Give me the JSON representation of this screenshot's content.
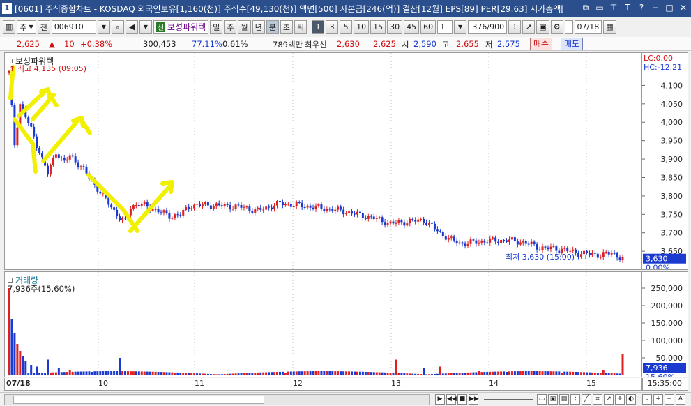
{
  "window": {
    "title": "[0601] 주식종합차트 - KOSDAQ 외국인보유[1,160(천)] 주식수[49,130(천)] 액면[500] 자본금[246(억)] 결산[12월] EPS[89] PER[29.63] 시가총액["
  },
  "toolbar": {
    "period_select": "주",
    "prefix": "전",
    "code": "006910",
    "name_badge": "신",
    "name": "보성파워텍",
    "period_buttons": [
      "일",
      "주",
      "월",
      "년",
      "분",
      "초",
      "틱"
    ],
    "interval_buttons": [
      "1",
      "3",
      "5",
      "10",
      "15",
      "30",
      "45",
      "60"
    ],
    "interval_select": "1",
    "count": "376",
    "count_max": "/900",
    "date": "07/18"
  },
  "pricebar": {
    "current": "2,625",
    "change_arrow": "▲",
    "change": "10",
    "change_pct": "+0.38%",
    "volume": "300,453",
    "volume_ratio": "77.11%",
    "turnover": "0.61%",
    "amount": "789백만",
    "best_label": "최우선",
    "best_ask": "2,630",
    "best_bid": "2,625",
    "open_label": "시",
    "open": "2,590",
    "high_label": "고",
    "high": "2,655",
    "low_label": "저",
    "low": "2,575",
    "buy_button": "매수",
    "sell_button": "매도"
  },
  "price_panel": {
    "legend": "보성파워텍",
    "high_note": "최고 4,135 (09:05)",
    "low_note": "최저 3,630 (15:00)",
    "lc": "LC:0.00",
    "hc": "HC:-12.21",
    "current_tag": "3,630",
    "current_pct": "0.00%",
    "y_ticks": [
      "4,100",
      "4,050",
      "4,000",
      "3,950",
      "3,900",
      "3,850",
      "3,800",
      "3,750",
      "3,700",
      "3,650"
    ]
  },
  "volume_panel": {
    "legend": "거래량",
    "note": "7,936주(15.60%)",
    "current_tag": "7,936",
    "current_pct": "15.60%",
    "y_ticks": [
      "250,000",
      "200,000",
      "150,000",
      "100,000",
      "50,000"
    ]
  },
  "xaxis": {
    "labels": [
      "07/18",
      "10",
      "11",
      "12",
      "13",
      "14",
      "15"
    ],
    "time": "15:35:00"
  },
  "colors": {
    "up": "#e02020",
    "down": "#1a3ad0",
    "annotation": "#f0f000",
    "titlebar": "#2b4f8c"
  },
  "chart_data": {
    "type": "candlestick",
    "title": "보성파워텍",
    "x_labels": [
      "07/18",
      "10",
      "11",
      "12",
      "13",
      "14",
      "15"
    ],
    "ylim": [
      3620,
      4150
    ],
    "price_path": [
      [
        0,
        4135
      ],
      [
        2,
        3940
      ],
      [
        4,
        4050
      ],
      [
        8,
        3980
      ],
      [
        12,
        3900
      ],
      [
        14,
        3860
      ],
      [
        17,
        3920
      ],
      [
        20,
        3890
      ],
      [
        22,
        3910
      ],
      [
        26,
        3880
      ],
      [
        30,
        3840
      ],
      [
        34,
        3800
      ],
      [
        38,
        3760
      ],
      [
        40,
        3740
      ],
      [
        42,
        3730
      ],
      [
        44,
        3770
      ],
      [
        47,
        3780
      ],
      [
        50,
        3770
      ],
      [
        54,
        3760
      ],
      [
        58,
        3745
      ],
      [
        62,
        3750
      ],
      [
        66,
        3775
      ],
      [
        74,
        3775
      ],
      [
        84,
        3770
      ],
      [
        90,
        3760
      ],
      [
        98,
        3780
      ],
      [
        110,
        3770
      ],
      [
        120,
        3760
      ],
      [
        132,
        3740
      ],
      [
        138,
        3725
      ],
      [
        144,
        3730
      ],
      [
        150,
        3735
      ],
      [
        156,
        3700
      ],
      [
        160,
        3680
      ],
      [
        164,
        3670
      ],
      [
        172,
        3678
      ],
      [
        180,
        3680
      ],
      [
        186,
        3675
      ],
      [
        192,
        3660
      ],
      [
        200,
        3655
      ],
      [
        206,
        3645
      ],
      [
        214,
        3640
      ],
      [
        218,
        3645
      ],
      [
        222,
        3630
      ]
    ],
    "volume_series": [
      [
        0,
        250000
      ],
      [
        1,
        160000
      ],
      [
        2,
        120000
      ],
      [
        3,
        90000
      ],
      [
        4,
        70000
      ],
      [
        5,
        55000
      ],
      [
        6,
        40000
      ],
      [
        8,
        30000
      ],
      [
        10,
        25000
      ],
      [
        14,
        45000
      ],
      [
        18,
        20000
      ],
      [
        22,
        15000
      ],
      [
        30,
        10000
      ],
      [
        40,
        50000
      ],
      [
        60,
        8000
      ],
      [
        100,
        6000
      ],
      [
        140,
        45000
      ],
      [
        150,
        20000
      ],
      [
        156,
        25000
      ],
      [
        170,
        12000
      ],
      [
        180,
        10000
      ],
      [
        200,
        8000
      ],
      [
        215,
        15000
      ],
      [
        222,
        60000
      ]
    ],
    "volume_ylim": [
      0,
      280000
    ],
    "high": {
      "value": 4135,
      "time": "09:05"
    },
    "low": {
      "value": 3630,
      "time": "15:00"
    }
  }
}
